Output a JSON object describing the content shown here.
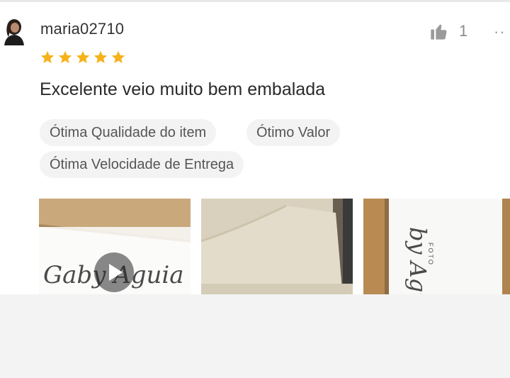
{
  "review": {
    "username": "maria02710",
    "rating": 5,
    "rating_max": 5,
    "like_count": "1",
    "more_label": "··",
    "comment": "Excelente veio muito bem embalada",
    "tags": [
      "Ótima Qualidade do item",
      "Ótimo Valor",
      "Ótima Velocidade de Entrega"
    ],
    "photos": [
      {
        "kind": "video",
        "icon": "play-icon",
        "overlay_text": "Gaby Aguia"
      },
      {
        "kind": "image"
      },
      {
        "kind": "image",
        "overlay_text": "by Agu",
        "small_text": "FOTO"
      }
    ]
  },
  "colors": {
    "star": "#f6b21b",
    "tag_bg": "#f3f3f3",
    "text_primary": "#2a2a2a",
    "text_muted": "#8a8a8a"
  }
}
